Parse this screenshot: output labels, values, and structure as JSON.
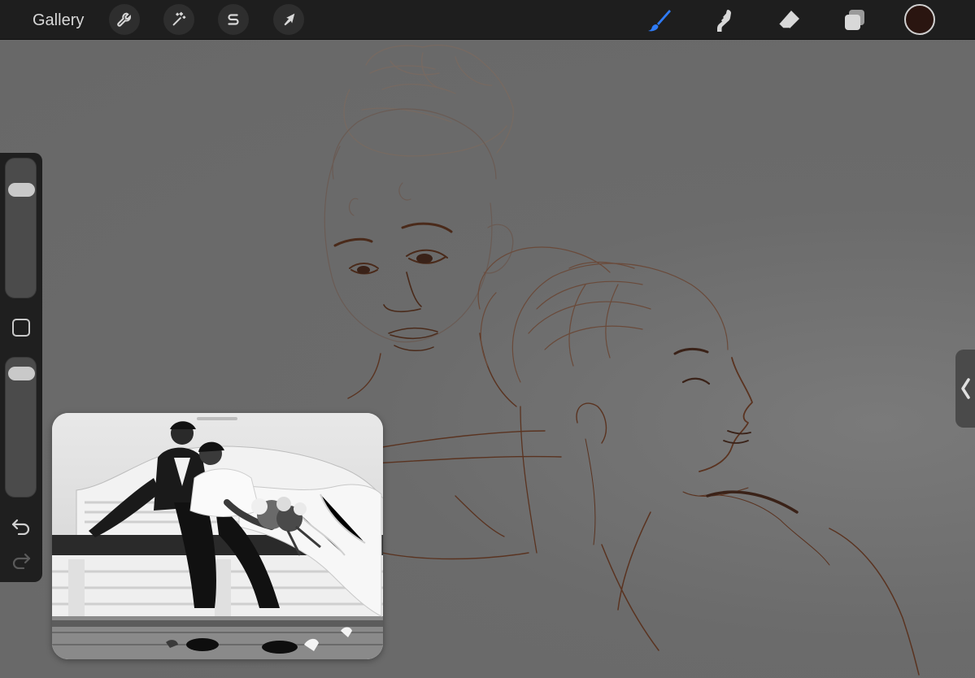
{
  "toolbar": {
    "gallery_label": "Gallery",
    "left_tools": [
      {
        "name": "actions",
        "icon": "wrench-icon"
      },
      {
        "name": "adjustments",
        "icon": "magic-wand-icon"
      },
      {
        "name": "selection",
        "icon": "selection-s-icon"
      },
      {
        "name": "transform",
        "icon": "arrow-cursor-icon"
      }
    ],
    "right_tools": [
      {
        "name": "brush",
        "icon": "brush-icon",
        "active": true
      },
      {
        "name": "smudge",
        "icon": "smudge-finger-icon"
      },
      {
        "name": "eraser",
        "icon": "eraser-icon"
      },
      {
        "name": "layers",
        "icon": "layers-icon"
      }
    ],
    "active_tool_color": "#2f7bf5",
    "current_color": "#2a1510"
  },
  "sidebar": {
    "brush_size_level": 0.18,
    "opacity_level": 0.05,
    "modify_icon": "square-outline-icon",
    "undo_icon": "undo-arrow-icon",
    "redo_icon": "redo-arrow-icon"
  },
  "right_panel": {
    "toggle_icon": "chevron-left-icon"
  },
  "reference": {
    "image_icon": "reference-photo-couple"
  },
  "canvas": {
    "sketch_color": "#5a3320",
    "background": "#6a6a6a"
  }
}
